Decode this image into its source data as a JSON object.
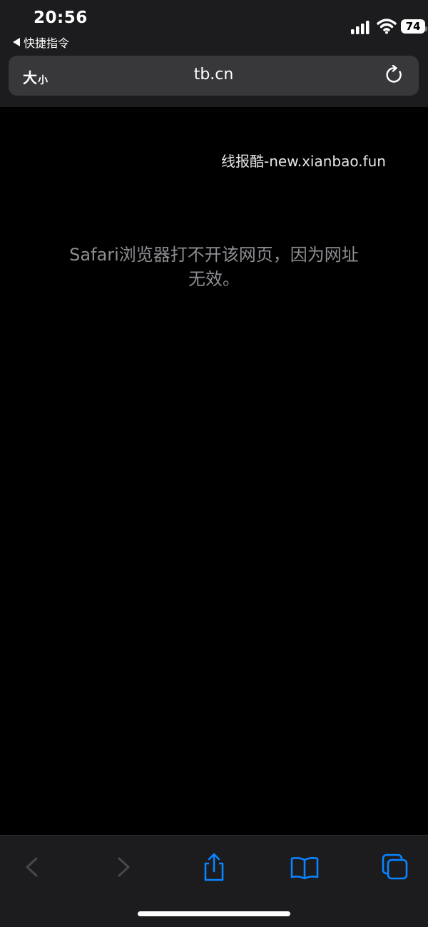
{
  "status_bar": {
    "time": "20:56",
    "back_app": "快捷指令",
    "battery": "74"
  },
  "address_bar": {
    "text_size_large": "大",
    "text_size_small": "小",
    "url": "tb.cn"
  },
  "page": {
    "watermark": "线报酷-new.xianbao.fun",
    "error_line1": "Safari浏览器打不开该网页，因为网址",
    "error_line2": "无效。"
  },
  "toolbar": {
    "icons": [
      "back-icon",
      "forward-icon",
      "share-icon",
      "bookmarks-icon",
      "tabs-icon"
    ]
  },
  "colors": {
    "accent": "#0a84ff",
    "disabled": "#48484a",
    "error_text": "#8e8e93"
  }
}
